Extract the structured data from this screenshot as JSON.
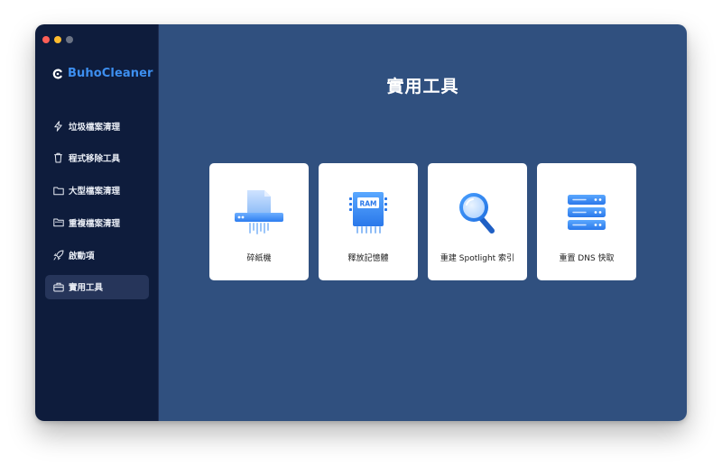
{
  "window": {
    "controls": [
      "close",
      "minimize",
      "zoom"
    ]
  },
  "brand": {
    "name": "BuhoCleaner",
    "color": "#3d8ff0"
  },
  "sidebar": {
    "items": [
      {
        "label": "垃圾檔案清理",
        "icon": "lightning-icon",
        "active": false
      },
      {
        "label": "程式移除工具",
        "icon": "trash-icon",
        "active": false
      },
      {
        "label": "大型檔案清理",
        "icon": "folder-icon",
        "active": false
      },
      {
        "label": "重複檔案清理",
        "icon": "folders-icon",
        "active": false
      },
      {
        "label": "啟動項",
        "icon": "rocket-icon",
        "active": false
      },
      {
        "label": "實用工具",
        "icon": "toolbox-icon",
        "active": true
      }
    ]
  },
  "main": {
    "title": "實用工具",
    "cards": [
      {
        "label": "碎紙機",
        "icon": "shredder-icon"
      },
      {
        "label": "釋放記憶體",
        "icon": "ram-chip-icon",
        "chip_text": "RAM"
      },
      {
        "label": "重建 Spotlight 索引",
        "icon": "magnifier-icon"
      },
      {
        "label": "重置 DNS 快取",
        "icon": "server-stack-icon"
      }
    ]
  },
  "colors": {
    "sidebar_bg": "#0e1c3c",
    "main_bg": "#30507f",
    "active_item_bg": "#26355a",
    "icon_blue": "#3d8ff0"
  }
}
